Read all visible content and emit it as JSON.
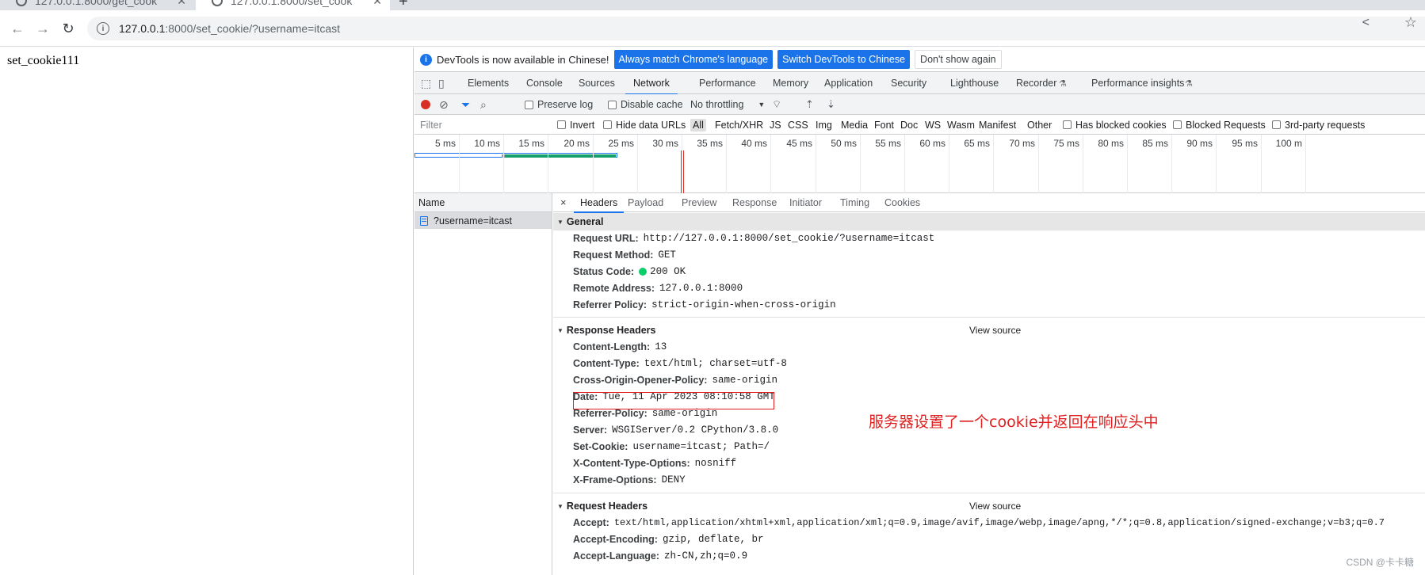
{
  "browser": {
    "tabs": [
      {
        "title": "127.0.0.1:8000/get_cook",
        "active": false
      },
      {
        "title": "127.0.0.1:8000/set_cook",
        "active": true
      }
    ],
    "new_tab": "+",
    "url_host": "127.0.0.1",
    "url_rest": ":8000/set_cookie/?username=itcast",
    "icons": {
      "back": "arrow-left-icon",
      "forward": "arrow-right-icon",
      "reload": "reload-icon",
      "info": "info-icon",
      "share": "share-icon",
      "star": "star-icon"
    }
  },
  "page": {
    "body_text": "set_cookie111"
  },
  "devtools": {
    "infobar": {
      "message": "DevTools is now available in Chinese!",
      "btn_match": "Always match Chrome's language",
      "btn_switch": "Switch DevTools to Chinese",
      "btn_dismiss": "Don't show again"
    },
    "tabs": [
      "Elements",
      "Console",
      "Sources",
      "Network",
      "Performance",
      "Memory",
      "Application",
      "Security",
      "Lighthouse",
      "Recorder",
      "Performance insights"
    ],
    "active_tab": "Network",
    "network_toolbar": {
      "preserve_log": "Preserve log",
      "disable_cache": "Disable cache",
      "throttling": "No throttling"
    },
    "filter_bar": {
      "placeholder": "Filter",
      "invert": "Invert",
      "hide_data_urls": "Hide data URLs",
      "types": [
        "All",
        "Fetch/XHR",
        "JS",
        "CSS",
        "Img",
        "Media",
        "Font",
        "Doc",
        "WS",
        "Wasm",
        "Manifest",
        "Other"
      ],
      "has_blocked_cookies": "Has blocked cookies",
      "blocked_requests": "Blocked Requests",
      "third_party": "3rd-party requests"
    },
    "timeline_labels": [
      "5 ms",
      "10 ms",
      "15 ms",
      "20 ms",
      "25 ms",
      "30 ms",
      "35 ms",
      "40 ms",
      "45 ms",
      "50 ms",
      "55 ms",
      "60 ms",
      "65 ms",
      "70 ms",
      "75 ms",
      "80 ms",
      "85 ms",
      "90 ms",
      "95 ms",
      "100 m"
    ],
    "name_column": "Name",
    "request_name": "?username=itcast",
    "detail_tabs": [
      "Headers",
      "Payload",
      "Preview",
      "Response",
      "Initiator",
      "Timing",
      "Cookies"
    ],
    "close_glyph": "×",
    "general": {
      "title": "General",
      "rows": [
        {
          "key": "Request URL:",
          "value": "http://127.0.0.1:8000/set_cookie/?username=itcast"
        },
        {
          "key": "Request Method:",
          "value": "GET"
        },
        {
          "key": "Status Code:",
          "value": "200 OK"
        },
        {
          "key": "Remote Address:",
          "value": "127.0.0.1:8000"
        },
        {
          "key": "Referrer Policy:",
          "value": "strict-origin-when-cross-origin"
        }
      ]
    },
    "response_headers": {
      "title": "Response Headers",
      "view_source": "View source",
      "rows": [
        {
          "key": "Content-Length:",
          "value": "13"
        },
        {
          "key": "Content-Type:",
          "value": "text/html; charset=utf-8"
        },
        {
          "key": "Cross-Origin-Opener-Policy:",
          "value": "same-origin"
        },
        {
          "key": "Date:",
          "value": "Tue, 11 Apr 2023 08:10:58 GMT"
        },
        {
          "key": "Referrer-Policy:",
          "value": "same-origin"
        },
        {
          "key": "Server:",
          "value": "WSGIServer/0.2 CPython/3.8.0"
        },
        {
          "key": "Set-Cookie:",
          "value": "username=itcast; Path=/"
        },
        {
          "key": "X-Content-Type-Options:",
          "value": "nosniff"
        },
        {
          "key": "X-Frame-Options:",
          "value": "DENY"
        }
      ]
    },
    "request_headers": {
      "title": "Request Headers",
      "view_source": "View source",
      "rows": [
        {
          "key": "Accept:",
          "value": "text/html,application/xhtml+xml,application/xml;q=0.9,image/avif,image/webp,image/apng,*/*;q=0.8,application/signed-exchange;v=b3;q=0.7"
        },
        {
          "key": "Accept-Encoding:",
          "value": "gzip, deflate, br"
        },
        {
          "key": "Accept-Language:",
          "value": "zh-CN,zh;q=0.9"
        }
      ]
    }
  },
  "annotation": "服务器设置了一个cookie并返回在响应头中",
  "watermark": "CSDN @卡卡糖",
  "colors": {
    "accent": "#1a73e8",
    "highlight": "#e02020",
    "status_ok": "#0cce6b"
  }
}
